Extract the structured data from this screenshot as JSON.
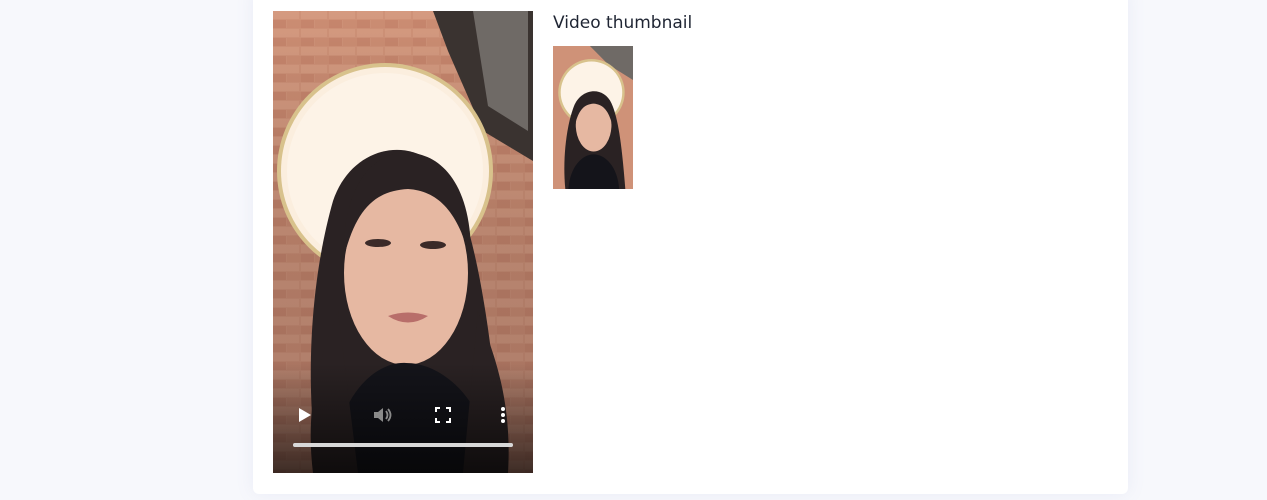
{
  "thumbnail_section": {
    "title": "Video thumbnail"
  },
  "video_player": {
    "progress_fraction": 1.0,
    "controls": {
      "play_icon": "play-icon",
      "volume_icon": "volume-icon",
      "fullscreen_icon": "fullscreen-icon",
      "more_icon": "more-options-icon"
    }
  },
  "colors": {
    "page_background": "#f7f8fc",
    "card_background": "#ffffff",
    "heading_text": "#1f2533",
    "brick": "#c98a70",
    "halo": "#fdf3e7",
    "halo_ring": "#d7c08a"
  }
}
